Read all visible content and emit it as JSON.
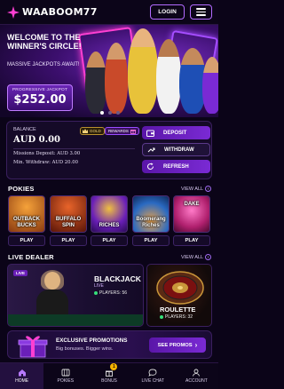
{
  "header": {
    "logo_prefix": "W",
    "logo_main": "AABOOM77",
    "login_label": "LOGIN"
  },
  "hero": {
    "title": "WELCOME TO THE WINNER'S CIRCLE!",
    "subtitle": "MASSIVE JACKPOTS AWAIT!",
    "jackpot_label": "PROGRESSIVE JACKPOT",
    "jackpot_value": "$252.00",
    "slides": 3,
    "active_slide": 0
  },
  "account": {
    "balance_label": "BALANCE",
    "balance_value": "AUD 0.00",
    "gold_label": "GOLD",
    "rewards_label": "REWARDS",
    "missions": "Missions Deposit: AUD 3.00",
    "min_withdraw": "Min. Withdraw: AUD 20.00",
    "deposit_label": "DEPOSIT",
    "withdraw_label": "WITHDRAW",
    "refresh_label": "REFRESH"
  },
  "pokies": {
    "title": "POKIES",
    "view_all": "VIEW ALL",
    "games": [
      {
        "name": "OUTBACK BUCKS",
        "play": "PLAY",
        "bg": "#c46a1f"
      },
      {
        "name": "BUFFALO SPIN",
        "play": "PLAY",
        "bg": "#b8321a"
      },
      {
        "name": "RICHES",
        "play": "PLAY",
        "bg": "#5a1f9e"
      },
      {
        "name": "Boomerang Riches",
        "play": "PLAY",
        "bg": "#1f5a9e"
      },
      {
        "name": "DAKE",
        "play": "PLAY",
        "bg": "#9e1f6a"
      }
    ]
  },
  "live_dealer": {
    "title": "LIVE DEALER",
    "view_all": "VIEW ALL",
    "live_tag": "LIVE",
    "blackjack": {
      "title": "BLACKJACK",
      "live": "LIVE",
      "players": "PLAYERS: 56"
    },
    "roulette": {
      "title": "ROULETTE",
      "players": "PLAYERS: 32"
    }
  },
  "promo": {
    "title": "EXCLUSIVE PROMOTIONS",
    "subtitle": "Big bonuses. Bigger wins.",
    "button": "SEE PROMOS"
  },
  "nav": {
    "items": [
      {
        "label": "HOME",
        "icon": "home-icon"
      },
      {
        "label": "POKIES",
        "icon": "pokies-icon"
      },
      {
        "label": "BONUS",
        "icon": "gift-icon",
        "badge": "1"
      },
      {
        "label": "LIVE CHAT",
        "icon": "chat-icon"
      },
      {
        "label": "ACCOUNT",
        "icon": "user-icon"
      }
    ]
  },
  "colors": {
    "background": "#0b0418",
    "accent": "#7a2ad4",
    "brand_pink": "#ff3fd2",
    "player_dot": "#36e07a"
  }
}
